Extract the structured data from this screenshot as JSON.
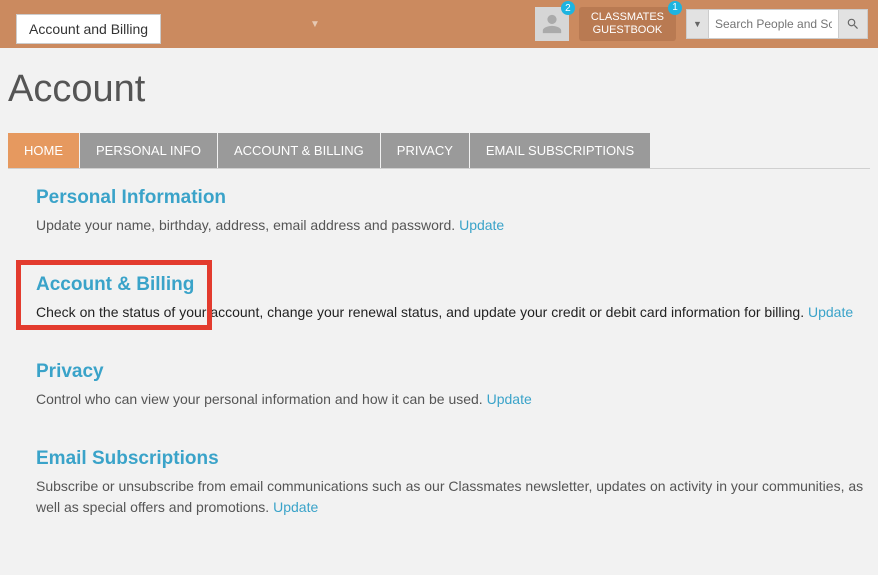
{
  "tooltip": "Account and Billing",
  "topbar": {
    "avatar_badge": "2",
    "guestbook_line1": "CLASSMATES",
    "guestbook_line2": "GUESTBOOK",
    "guestbook_badge": "1",
    "search_placeholder": "Search People and Sch"
  },
  "page_title": "Account",
  "tabs": [
    {
      "label": "HOME",
      "active": true
    },
    {
      "label": "PERSONAL INFO",
      "active": false
    },
    {
      "label": "ACCOUNT & BILLING",
      "active": false
    },
    {
      "label": "PRIVACY",
      "active": false
    },
    {
      "label": "EMAIL SUBSCRIPTIONS",
      "active": false
    }
  ],
  "sections": {
    "personal": {
      "title": "Personal Information",
      "desc": "Update your name, birthday, address, email address and password.",
      "link": "Update"
    },
    "billing": {
      "title": "Account & Billing",
      "desc": "Check on the status of your account, change your renewal status, and update your credit or debit card information for billing.",
      "link": "Update"
    },
    "privacy": {
      "title": "Privacy",
      "desc": "Control who can view your personal information and how it can be used.",
      "link": "Update"
    },
    "email": {
      "title": "Email Subscriptions",
      "desc": "Subscribe or unsubscribe from email communications such as our Classmates newsletter, updates on activity in your communities, as well as special offers and promotions.",
      "link": "Update"
    }
  }
}
